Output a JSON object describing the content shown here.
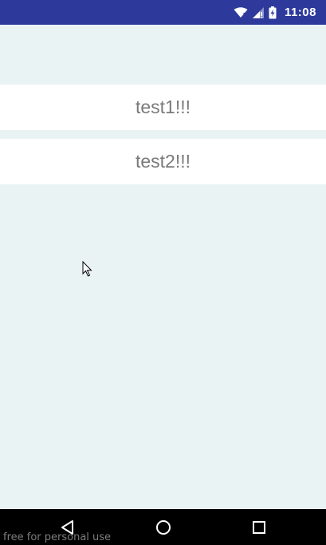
{
  "status_bar": {
    "time": "11:08",
    "icons": [
      "wifi-icon",
      "cell-signal-icon",
      "battery-charging-icon"
    ]
  },
  "list": {
    "items": [
      {
        "label": "test1!!!"
      },
      {
        "label": "test2!!!"
      }
    ]
  },
  "nav_bar": {
    "buttons": [
      "back-icon",
      "home-icon",
      "recents-icon"
    ]
  },
  "watermark": "free for personal use",
  "colors": {
    "status_bar": "#2d3a9c",
    "background": "#eaf3f4",
    "list_item_bg": "#ffffff",
    "list_item_text": "#7a7a7a",
    "nav_bar": "#000000"
  }
}
